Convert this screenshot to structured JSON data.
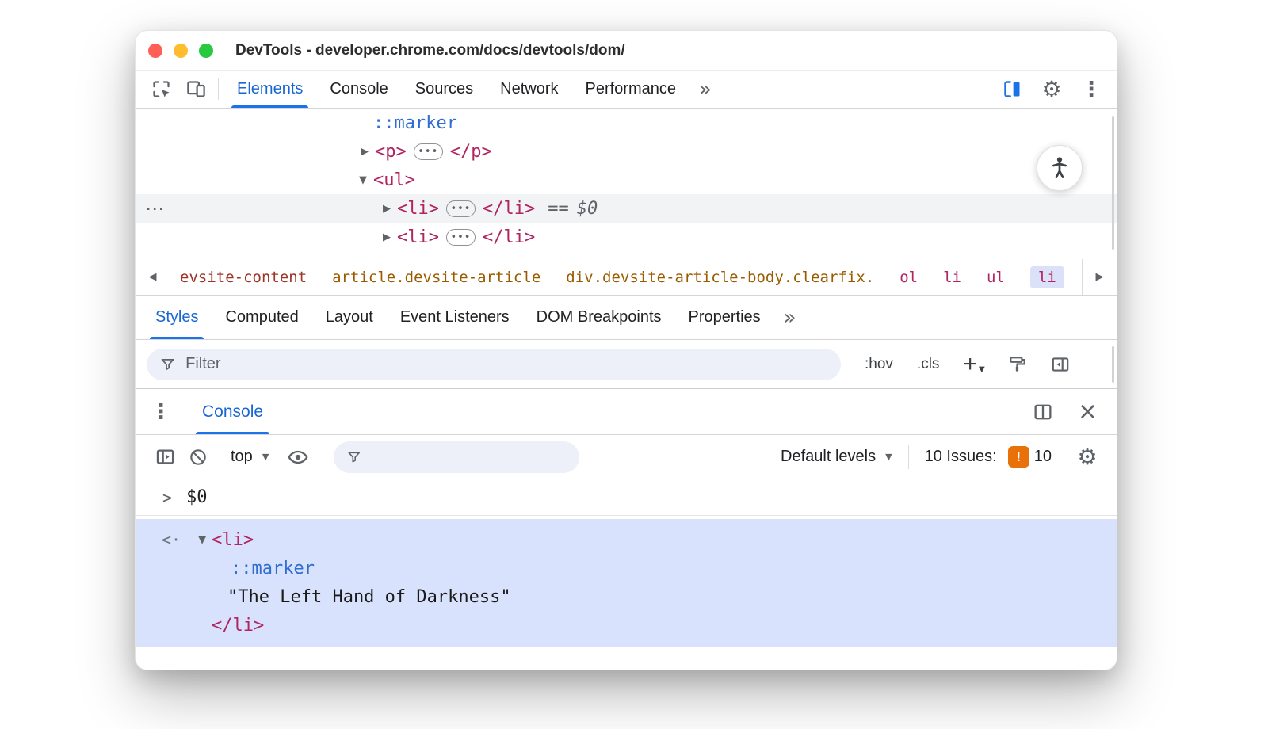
{
  "window": {
    "title": "DevTools - developer.chrome.com/docs/devtools/dom/"
  },
  "icons": {
    "settings": "⚙",
    "menu_vertical": "⋮",
    "overflow_tabs": "»",
    "close": "×",
    "back": "◀",
    "forward": "▶",
    "caret_down": "▼",
    "collapsed": "▶",
    "expanded": "▼",
    "more_dots": "⋯",
    "ellipsis": "•••",
    "prompt": ">",
    "result_marker": "<·"
  },
  "toolbar": {
    "tabs": [
      {
        "label": "Elements",
        "active": true
      },
      {
        "label": "Console",
        "active": false
      },
      {
        "label": "Sources",
        "active": false
      },
      {
        "label": "Network",
        "active": false
      },
      {
        "label": "Performance",
        "active": false
      }
    ]
  },
  "dom_tree": {
    "marker_row": {
      "text": "::marker"
    },
    "p_row": {
      "open": "<p>",
      "close": "</p>"
    },
    "ul_row": {
      "open": "<ul>"
    },
    "li_row_selected": {
      "open": "<li>",
      "close": "</li>",
      "eq": "==",
      "ref": "$0"
    },
    "li_row_2": {
      "open": "<li>",
      "close": "</li>"
    }
  },
  "breadcrumbs": {
    "items": [
      {
        "label": "evsite-content",
        "selected": false
      },
      {
        "label": "article.devsite-article",
        "selected": false
      },
      {
        "label": "div.devsite-article-body.clearfix.",
        "selected": false
      },
      {
        "label": "ol",
        "selected": false
      },
      {
        "label": "li",
        "selected": false
      },
      {
        "label": "ul",
        "selected": false
      },
      {
        "label": "li",
        "selected": true
      }
    ]
  },
  "styles_panel": {
    "tabs": [
      {
        "label": "Styles",
        "active": true
      },
      {
        "label": "Computed",
        "active": false
      },
      {
        "label": "Layout",
        "active": false
      },
      {
        "label": "Event Listeners",
        "active": false
      },
      {
        "label": "DOM Breakpoints",
        "active": false
      },
      {
        "label": "Properties",
        "active": false
      }
    ],
    "filter_placeholder": "Filter",
    "hov_label": ":hov",
    "cls_label": ".cls",
    "plus_label": "+"
  },
  "drawer": {
    "tab_label": "Console"
  },
  "console": {
    "context_selector": "top",
    "levels_selector": "Default levels",
    "issues_label": "10 Issues:",
    "issues_bang": "!",
    "issues_count": "10",
    "echo_expression": "$0",
    "result": {
      "li_open": "<li>",
      "pseudo": "::marker",
      "text_node": "\"The Left Hand of Darkness\"",
      "li_close": "</li>"
    }
  },
  "colors": {
    "accent_blue": "#1a73e8",
    "active_tab_blue": "#1967d2",
    "tag_color": "#b02460",
    "pseudo_blue": "#2f6dd0",
    "crumb_class_color": "#9a5b00",
    "crumb_id_color": "#9c3428",
    "issues_orange": "#e8710a",
    "selected_row_gray": "#f1f3f4",
    "selection_blue": "#d9e2fc"
  }
}
